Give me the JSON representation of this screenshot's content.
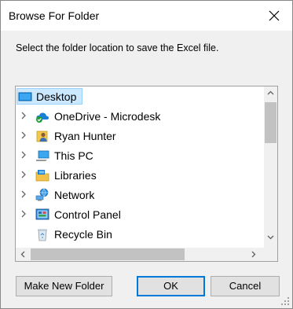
{
  "window": {
    "title": "Browse For Folder"
  },
  "prompt": "Select the folder location to save the Excel file.",
  "tree": {
    "items": [
      {
        "label": "Desktop",
        "icon": "desktop-icon",
        "expandable": false,
        "selected": true
      },
      {
        "label": "OneDrive - Microdesk",
        "icon": "onedrive-cloud-icon",
        "expandable": true
      },
      {
        "label": "Ryan Hunter",
        "icon": "user-folder-icon",
        "expandable": true
      },
      {
        "label": "This PC",
        "icon": "computer-icon",
        "expandable": true
      },
      {
        "label": "Libraries",
        "icon": "libraries-icon",
        "expandable": true
      },
      {
        "label": "Network",
        "icon": "network-icon",
        "expandable": true
      },
      {
        "label": "Control Panel",
        "icon": "control-panel-icon",
        "expandable": true
      },
      {
        "label": "Recycle Bin",
        "icon": "recycle-bin-icon",
        "expandable": false
      }
    ]
  },
  "buttons": {
    "make_new_folder": "Make New Folder",
    "ok": "OK",
    "cancel": "Cancel"
  },
  "colors": {
    "selection_bg": "#cce8ff",
    "selection_border": "#99d1ff",
    "default_button_border": "#0078d7"
  }
}
